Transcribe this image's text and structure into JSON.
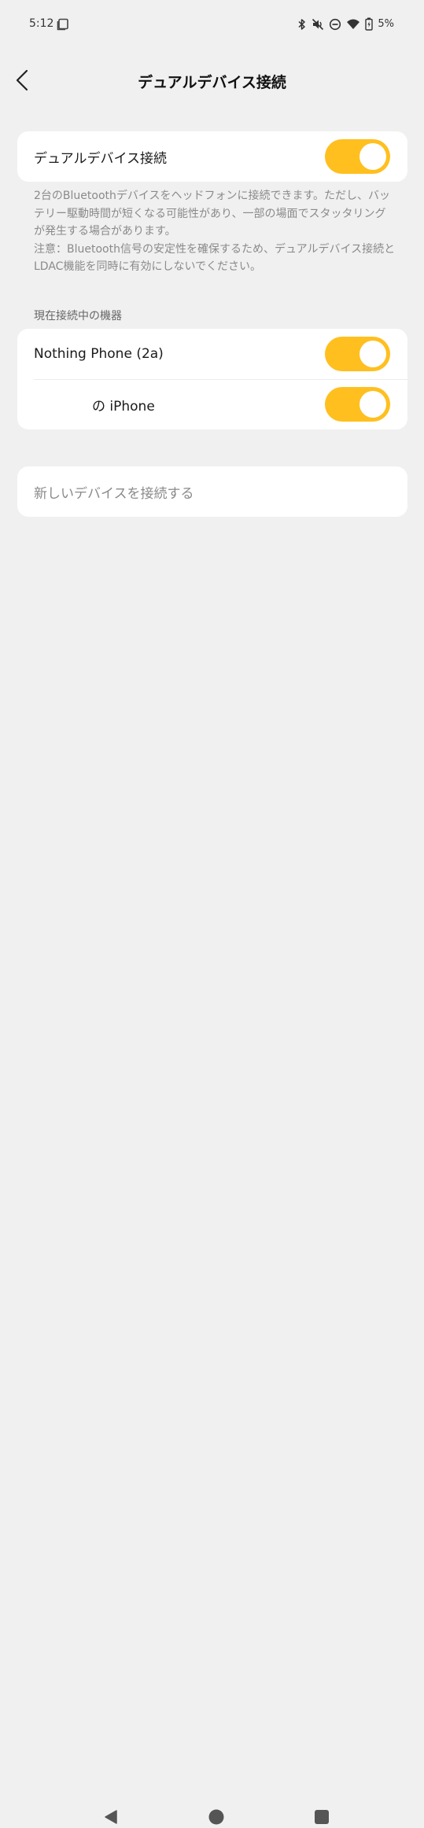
{
  "status_bar": {
    "time": "5:12",
    "battery_percent": "5%",
    "icons": [
      "screen-icon",
      "bluetooth-icon",
      "mute-icon",
      "dnd-icon",
      "wifi-icon",
      "battery-icon"
    ]
  },
  "header": {
    "title": "デュアルデバイス接続",
    "back_icon": "chevron-left-icon"
  },
  "dual_device": {
    "label": "デュアルデバイス接続",
    "enabled": true
  },
  "description": {
    "line1": "2台のBluetoothデバイスをヘッドフォンに接続できます。ただし、バッテリー駆動時間が短くなる可能性があり、一部の場面でスタッタリングが発生する場合があります。",
    "line2": "注意：Bluetooth信号の安定性を確保するため、デュアルデバイス接続とLDAC機能を同時に有効にしないでください。"
  },
  "connected_section": {
    "label": "現在接続中の機器",
    "devices": [
      {
        "name": "Nothing Phone (2a)",
        "enabled": true
      },
      {
        "name": "の iPhone",
        "enabled": true
      }
    ]
  },
  "new_device": {
    "label": "新しいデバイスを接続する"
  },
  "colors": {
    "accent": "#ffbf1f",
    "background": "#f0f0f0",
    "card": "#ffffff"
  }
}
